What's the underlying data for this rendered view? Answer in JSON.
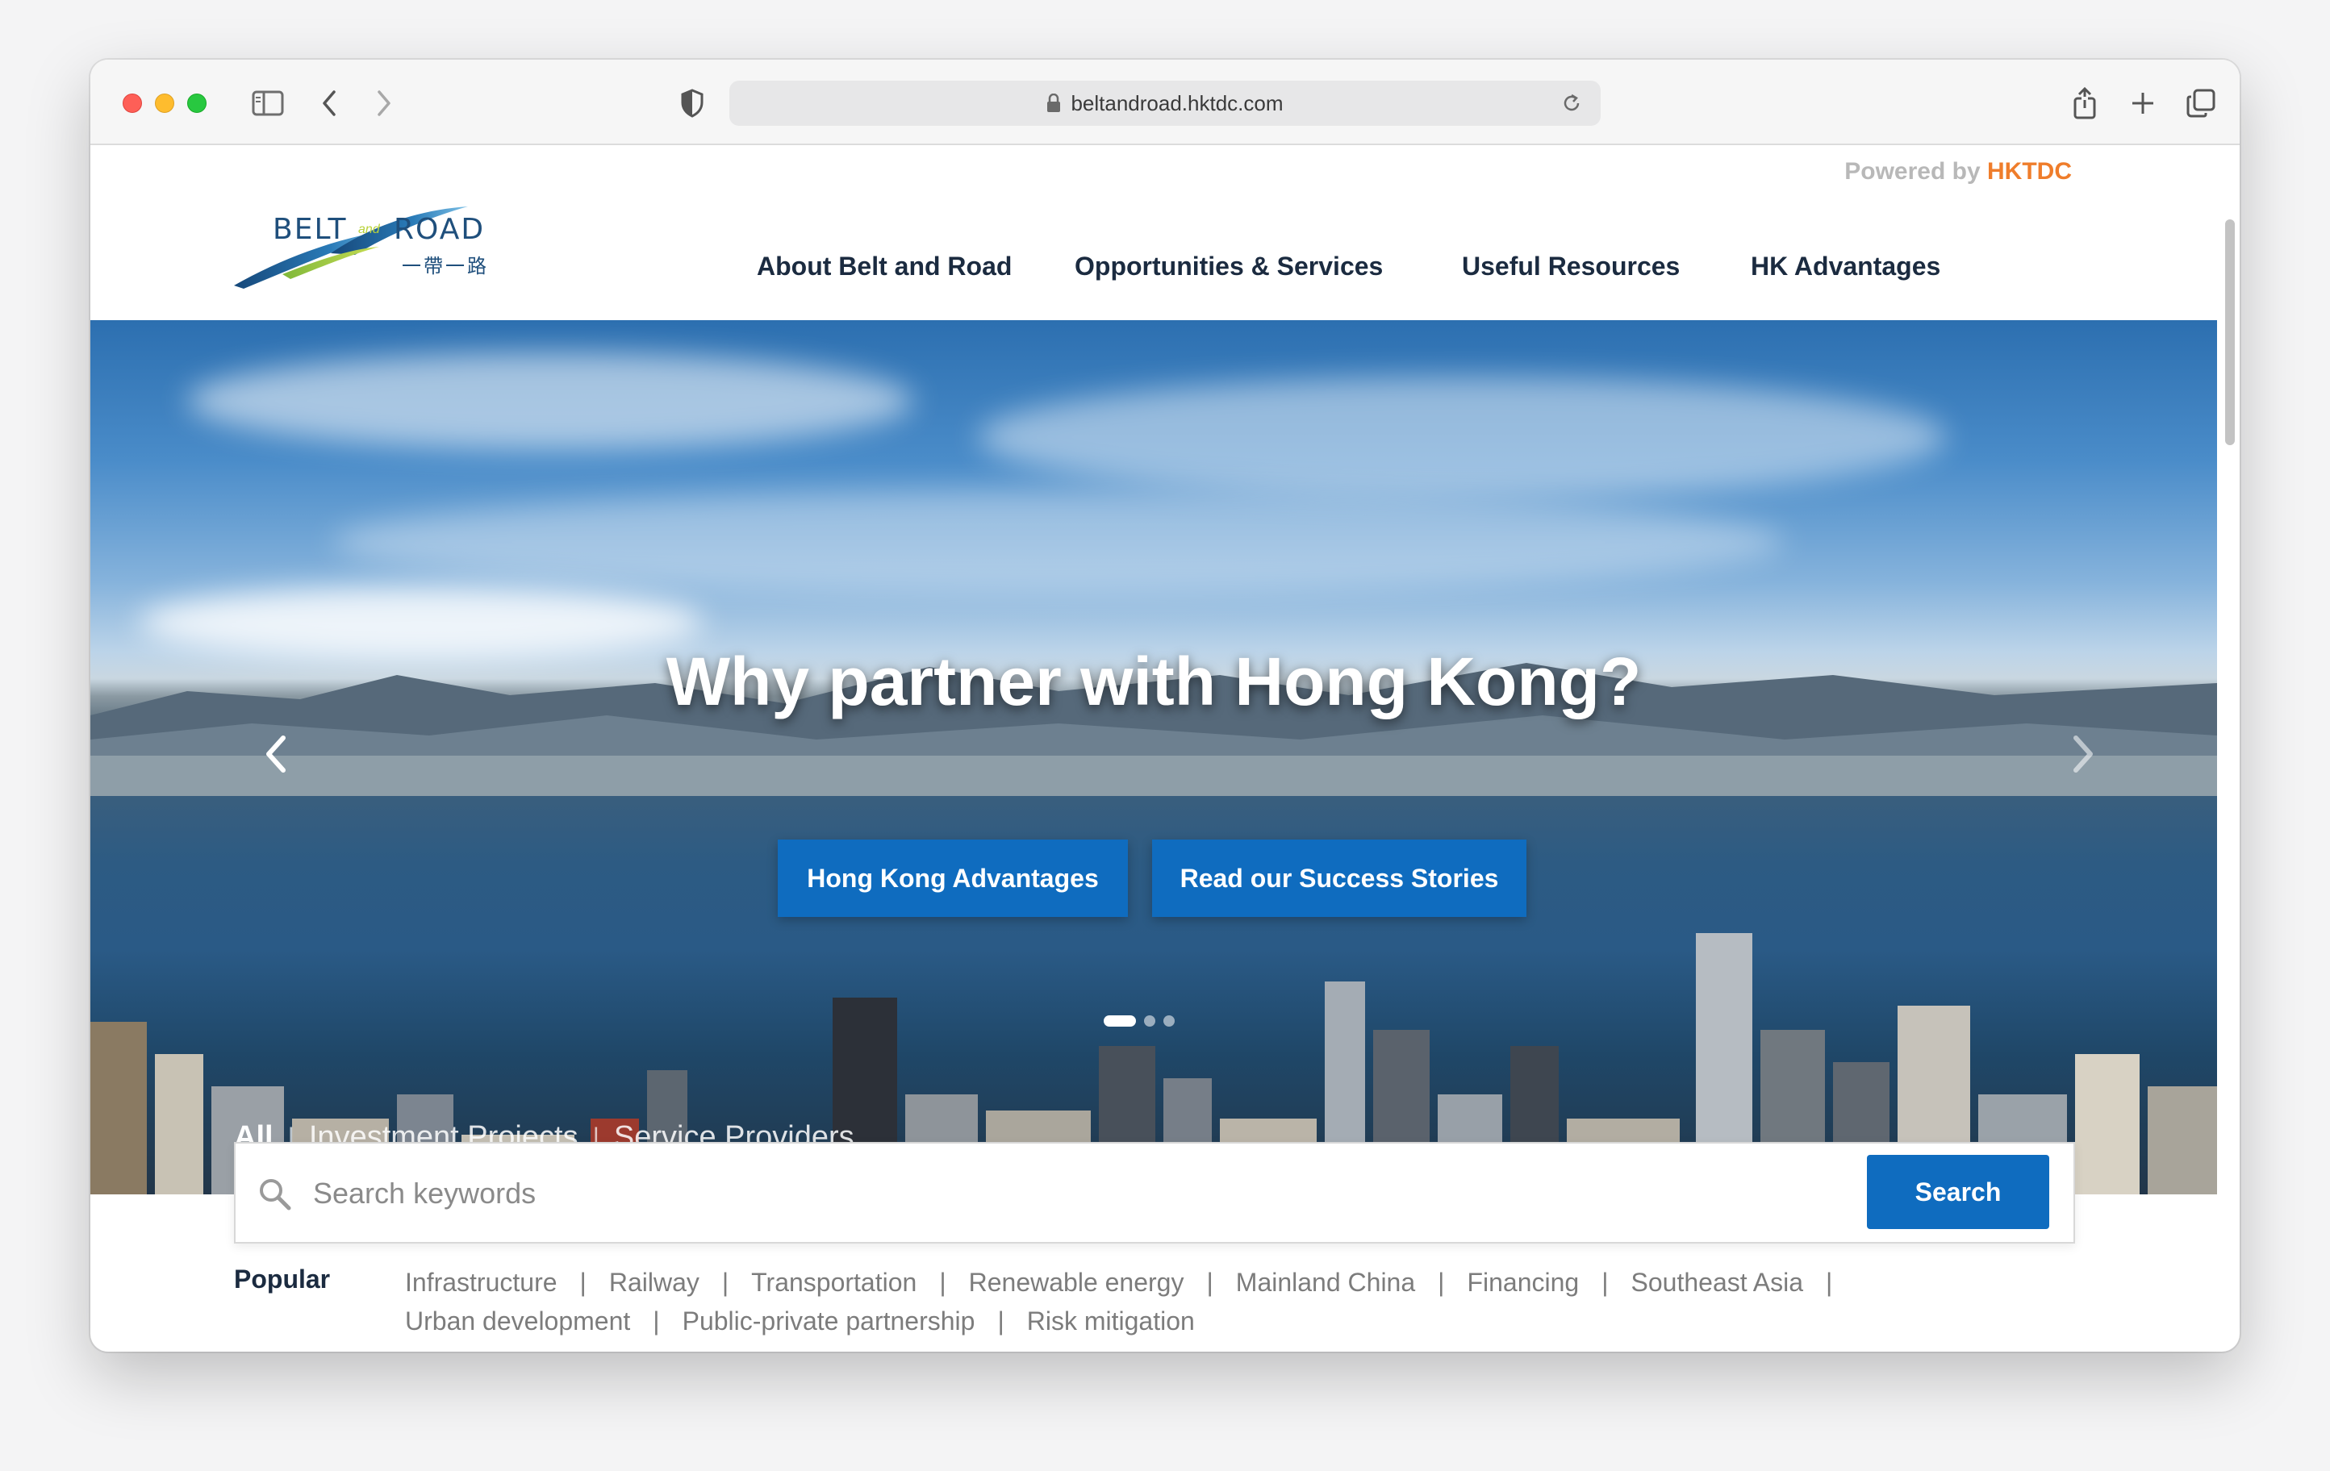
{
  "browser": {
    "url": "beltandroad.hktdc.com",
    "icons": [
      "sidebar-toggle-icon",
      "back-icon",
      "forward-icon",
      "shield-icon",
      "lock-icon",
      "reload-icon",
      "share-icon",
      "new-tab-icon",
      "tab-overview-icon"
    ]
  },
  "header": {
    "powered_by": "Powered by",
    "powered_brand": "HKTDC",
    "logo": {
      "word1": "BELT",
      "word_and": "and",
      "word2": "ROAD",
      "chinese": "一帶一路"
    },
    "nav": [
      {
        "label": "About Belt and Road"
      },
      {
        "label": "Opportunities & Services"
      },
      {
        "label": "Useful Resources"
      },
      {
        "label": "HK Advantages"
      }
    ]
  },
  "hero": {
    "title": "Why partner with Hong Kong?",
    "buttons": [
      {
        "label": "Hong Kong Advantages"
      },
      {
        "label": "Read our Success Stories"
      }
    ],
    "slide_count": 3,
    "active_slide": 1
  },
  "search": {
    "tabs": [
      {
        "label": "All",
        "active": true
      },
      {
        "label": "Investment Projects",
        "active": false
      },
      {
        "label": "Service Providers",
        "active": false
      }
    ],
    "tab_separator": "|",
    "placeholder": "Search keywords",
    "button_label": "Search",
    "popular_label": "Popular",
    "popular": [
      "Infrastructure",
      "Railway",
      "Transportation",
      "Renewable energy",
      "Mainland China",
      "Financing",
      "Southeast Asia",
      "Urban development",
      "Public-private partnership",
      "Risk mitigation"
    ],
    "popular_separator": "|"
  },
  "colors": {
    "accent": "#0f6cbf",
    "brand_orange": "#ef7d2b",
    "nav_text": "#1b2b40",
    "muted_text": "#7c7c7c"
  }
}
